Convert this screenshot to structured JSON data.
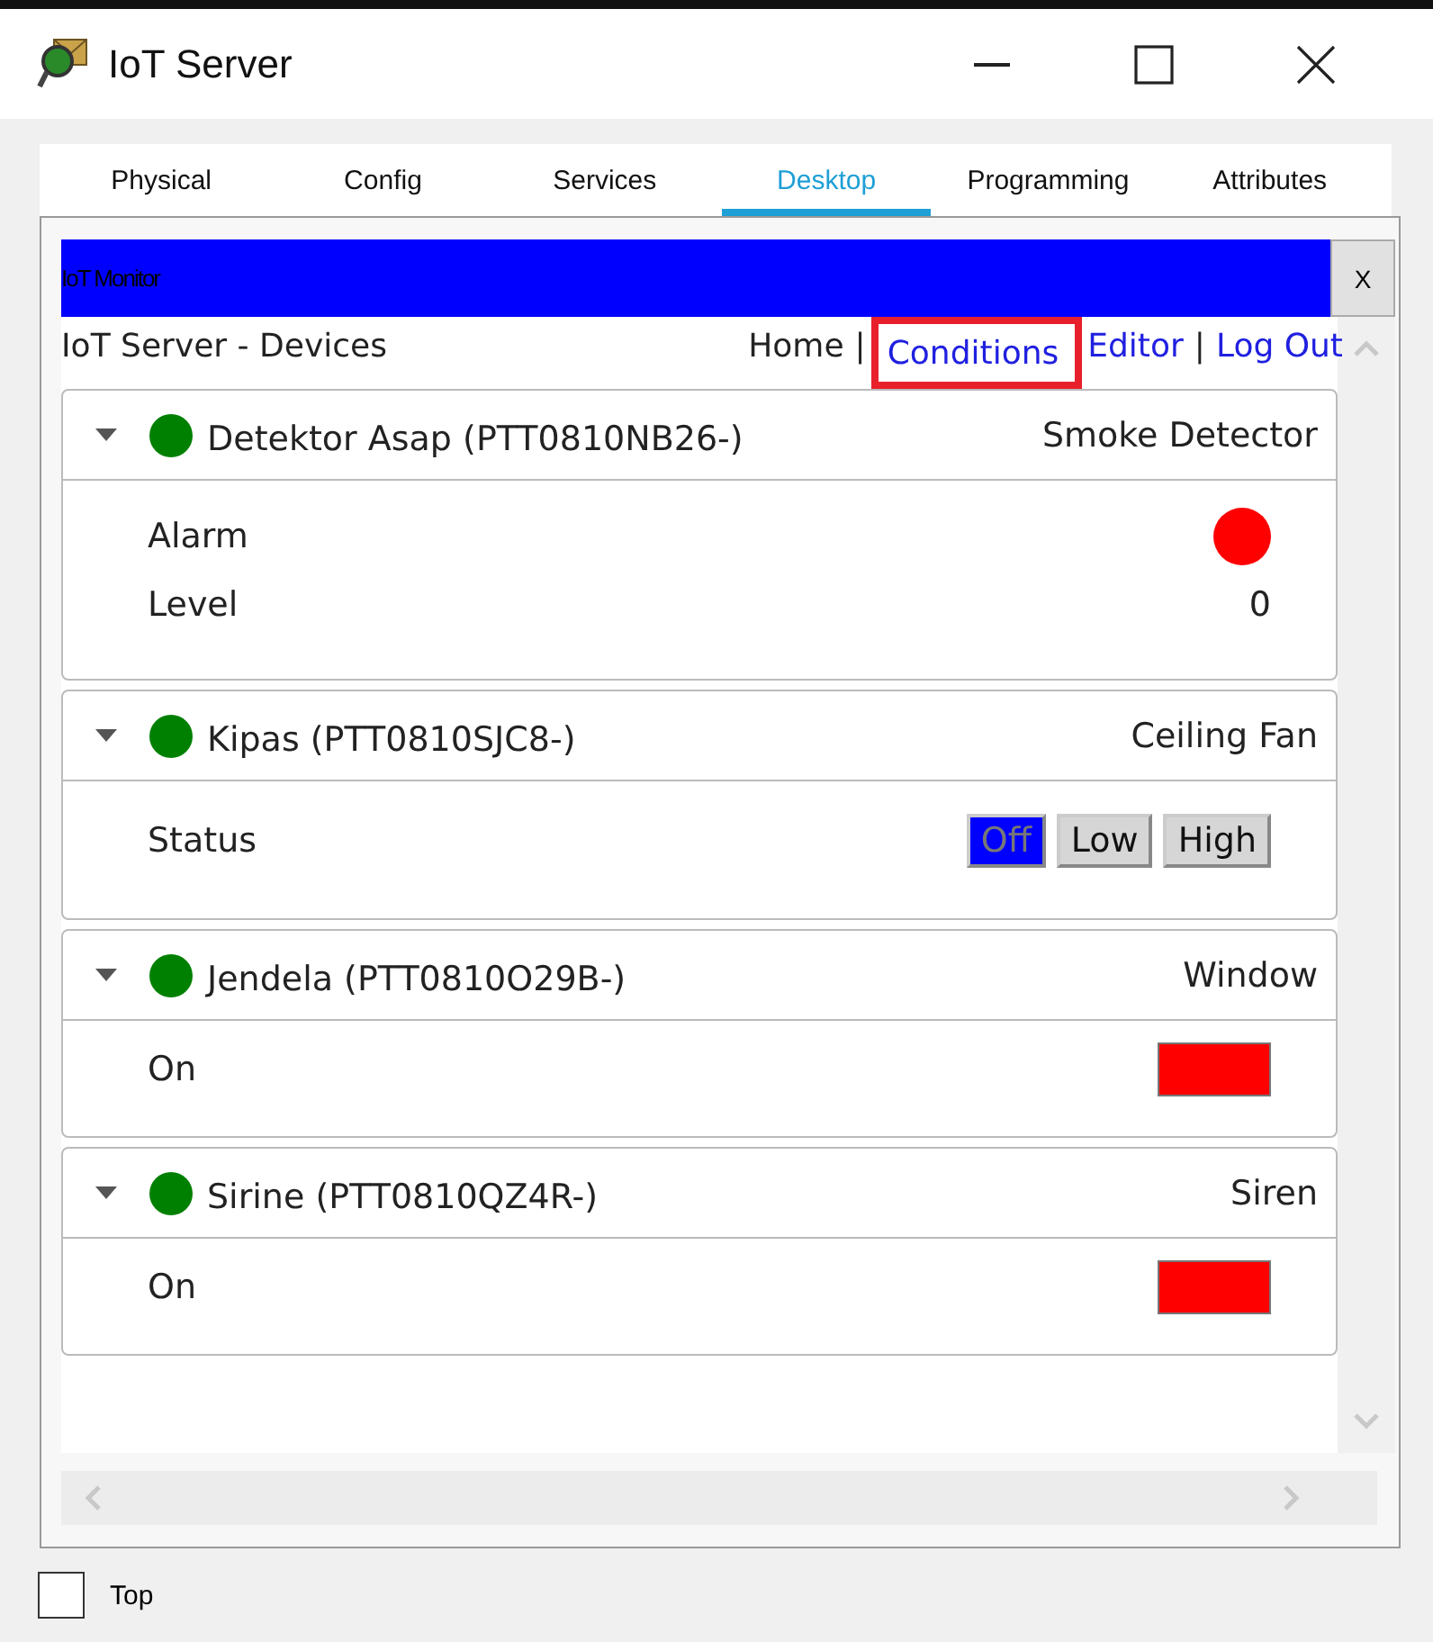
{
  "window": {
    "title": "IoT Server"
  },
  "tabs": [
    {
      "label": "Physical",
      "selected": false
    },
    {
      "label": "Config",
      "selected": false
    },
    {
      "label": "Services",
      "selected": false
    },
    {
      "label": "Desktop",
      "selected": true
    },
    {
      "label": "Programming",
      "selected": false
    },
    {
      "label": "Attributes",
      "selected": false
    }
  ],
  "app_bar": {
    "title": "IoT Monitor",
    "close": "X"
  },
  "page_title": "IoT Server - Devices",
  "nav": [
    {
      "label": "Home",
      "kind": "text",
      "highlighted": false
    },
    {
      "label": "|",
      "kind": "separator",
      "highlighted": false
    },
    {
      "label": "Conditions",
      "kind": "link",
      "highlighted": true
    },
    {
      "label": "Editor",
      "kind": "link",
      "highlighted": false
    },
    {
      "label": "|",
      "kind": "separator",
      "highlighted": false
    },
    {
      "label": "Log Out",
      "kind": "link",
      "highlighted": false
    }
  ],
  "devices": [
    {
      "name": "Detektor Asap (PTT0810NB26-)",
      "type": "Smoke Detector",
      "color": "#008000",
      "expanded": true,
      "properties": [
        {
          "label": "Alarm",
          "kind": "dot",
          "color": "#ff0000"
        },
        {
          "label": "Level",
          "kind": "text",
          "value": "0"
        }
      ]
    },
    {
      "name": "Kipas (PTT0810SJC8-)",
      "type": "Ceiling Fan",
      "color": "#008000",
      "expanded": true,
      "properties": [
        {
          "label": "Status",
          "kind": "options",
          "options": [
            {
              "label": "Off",
              "selected": true
            },
            {
              "label": "Low",
              "selected": false
            },
            {
              "label": "High",
              "selected": false
            }
          ]
        }
      ]
    },
    {
      "name": "Jendela (PTT0810O29B-)",
      "type": "Window",
      "color": "#008000",
      "expanded": true,
      "properties": [
        {
          "label": "On",
          "kind": "swatch",
          "color": "#ff0000"
        }
      ]
    },
    {
      "name": "Sirine (PTT0810QZ4R-)",
      "type": "Siren",
      "color": "#008000",
      "expanded": true,
      "properties": [
        {
          "label": "On",
          "kind": "swatch",
          "color": "#ff0000"
        }
      ]
    }
  ],
  "footer": {
    "label": "Top",
    "checked": false
  }
}
